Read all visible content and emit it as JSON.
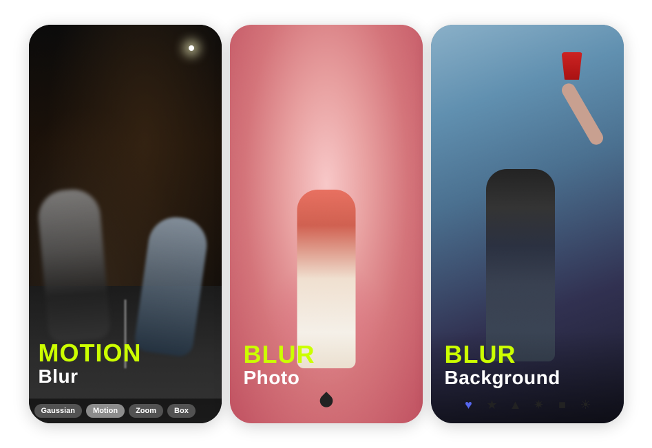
{
  "cards": [
    {
      "id": "card-1",
      "title_main": "MOTION",
      "title_sub": "Blur",
      "theme": "dark",
      "pills": [
        {
          "label": "Gaussian",
          "active": false
        },
        {
          "label": "Motion",
          "active": true
        },
        {
          "label": "Zoom",
          "active": false
        },
        {
          "label": "Box",
          "active": false
        }
      ]
    },
    {
      "id": "card-2",
      "title_main": "BLUR",
      "title_sub": "Photo",
      "theme": "pink",
      "icon": "droplet"
    },
    {
      "id": "card-3",
      "title_main": "BLUR",
      "title_sub": "Background",
      "theme": "party",
      "icons": [
        "heart",
        "star",
        "triangle",
        "gamepad",
        "square",
        "cloud"
      ]
    }
  ],
  "accent_color": "#ccff00",
  "labels": {
    "card1_title_main": "MOTION",
    "card1_title_sub": "Blur",
    "card2_title_main": "BLUR",
    "card2_title_sub": "Photo",
    "card3_title_main": "BLUR",
    "card3_title_sub": "Background",
    "pill_gaussian": "Gaussian",
    "pill_motion": "Motion",
    "pill_zoom": "Zoom",
    "pill_box": "Box"
  }
}
